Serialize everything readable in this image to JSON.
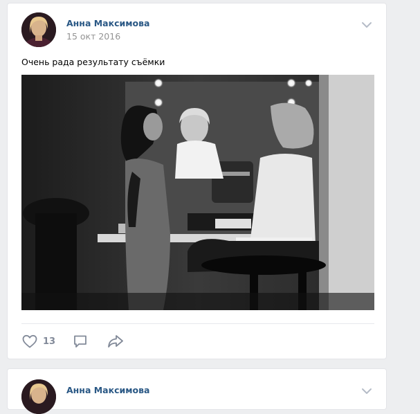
{
  "posts": [
    {
      "author": "Анна Максимова",
      "date": "15 окт 2016",
      "text": "Очень рада результату съёмки",
      "likes": "13",
      "photo_icon": "bw-photo-makeup-room",
      "actions": [
        "heart-icon",
        "comment-icon",
        "share-icon"
      ]
    },
    {
      "author": "Анна Максимова"
    }
  ],
  "colors": {
    "author_link": "#2a5885",
    "muted": "#828a99",
    "page_bg": "#edeef0"
  }
}
